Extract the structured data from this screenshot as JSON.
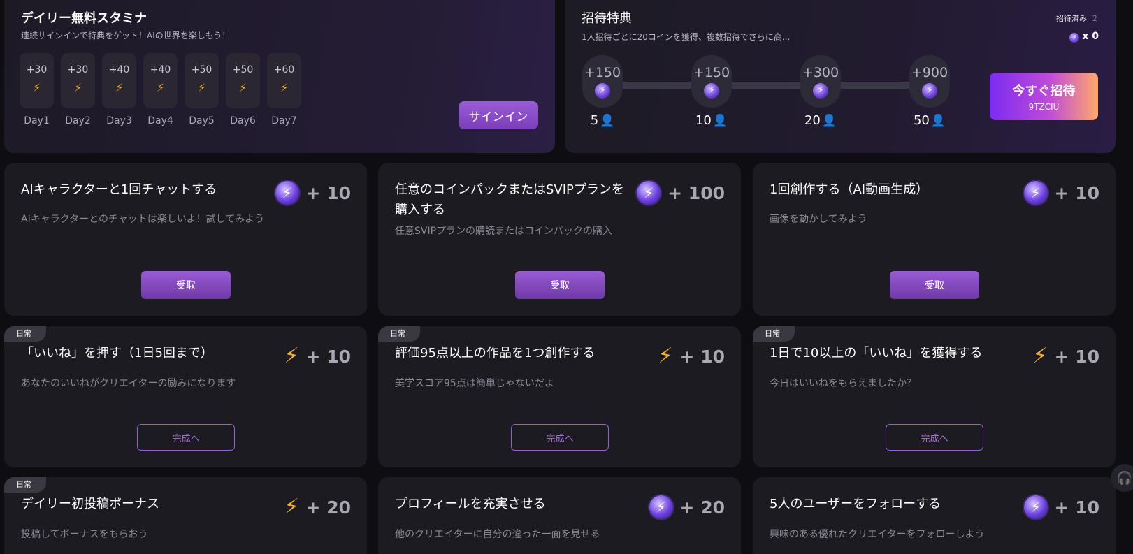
{
  "daily": {
    "title": "デイリー無料スタミナ",
    "subtitle": "連続サインインで特典をゲット！AIの世界を楽しもう！",
    "days": [
      {
        "points": "+30",
        "label": "Day1"
      },
      {
        "points": "+30",
        "label": "Day2"
      },
      {
        "points": "+40",
        "label": "Day3"
      },
      {
        "points": "+40",
        "label": "Day4"
      },
      {
        "points": "+50",
        "label": "Day5"
      },
      {
        "points": "+50",
        "label": "Day6"
      },
      {
        "points": "+60",
        "label": "Day7"
      }
    ],
    "signin_label": "サインイン"
  },
  "invite": {
    "title": "招待特典",
    "subtitle": "1人招待ごとに20コインを獲得、複数招待でさらに高...",
    "invited_label": "招待済み",
    "invited_count": "2",
    "coins": "x 0",
    "milestones": [
      {
        "points": "+150",
        "people": "5"
      },
      {
        "points": "+150",
        "people": "10"
      },
      {
        "points": "+300",
        "people": "20"
      },
      {
        "points": "+900",
        "people": "50"
      }
    ],
    "button_label": "今すぐ招待",
    "invite_code": "9TZCIU"
  },
  "tasks": [
    {
      "title": "AIキャラクターと1回チャットする",
      "desc": "AIキャラクターとのチャットは楽しいよ！試してみよう",
      "reward": "+ 10",
      "icon": "energy-orb-icon",
      "button": "受取"
    },
    {
      "title": "任意のコインパックまたはSVIPプランを購入する",
      "desc": "任意SVIPプランの購読またはコインパックの購入",
      "reward": "+ 100",
      "icon": "energy-orb-icon",
      "button": "受取"
    },
    {
      "title": "1回創作する（AI動画生成）",
      "desc": "画像を動かしてみよう",
      "reward": "+ 10",
      "icon": "energy-orb-icon",
      "button": "受取"
    },
    {
      "tag": "日常",
      "title": "「いいね」を押す（1日5回まで）",
      "desc": "あなたのいいねがクリエイターの励みになります",
      "reward": "+ 10",
      "icon": "lightning-bolt-icon",
      "button": "完成へ"
    },
    {
      "tag": "日常",
      "title": "評価95点以上の作品を1つ創作する",
      "desc": "美学スコア95点は簡単じゃないだよ",
      "reward": "+ 10",
      "icon": "lightning-bolt-icon",
      "button": "完成へ"
    },
    {
      "tag": "日常",
      "title": "1日で10以上の「いいね」を獲得する",
      "desc": "今日はいいねをもらえましたか？",
      "reward": "+ 10",
      "icon": "lightning-bolt-icon",
      "button": "完成へ"
    },
    {
      "tag": "日常",
      "title": "デイリー初投稿ボーナス",
      "desc": "投稿してボーナスをもらおう",
      "reward": "+ 20",
      "icon": "lightning-bolt-icon"
    },
    {
      "title": "プロフィールを充実させる",
      "desc": "他のクリエイターに自分の違った一面を見せる",
      "reward": "+ 20",
      "icon": "energy-orb-icon"
    },
    {
      "title": "5人のユーザーをフォローする",
      "desc": "興味のある優れたクリエイターをフォローしよう",
      "reward": "+ 10",
      "icon": "energy-orb-icon"
    }
  ],
  "colors": {
    "accent": "#9b5ed6",
    "bolt": "#f5b01a",
    "card": "#1c1b21",
    "background": "#0e0e12"
  }
}
